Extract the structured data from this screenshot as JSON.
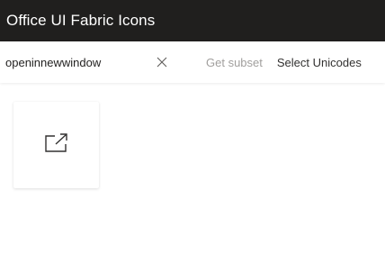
{
  "app": {
    "title": "Office UI Fabric Icons"
  },
  "toolbar": {
    "search_value": "openinnewwindow",
    "clear_icon": "close-icon",
    "get_subset_label": "Get subset",
    "select_unicodes_label": "Select Unicodes"
  },
  "results": [
    {
      "icon": "open-in-new-window-icon"
    }
  ],
  "colors": {
    "header_bg": "#201f1e",
    "header_text": "#ffffff",
    "disabled_text": "#a19f9d",
    "body_text": "#323130"
  }
}
